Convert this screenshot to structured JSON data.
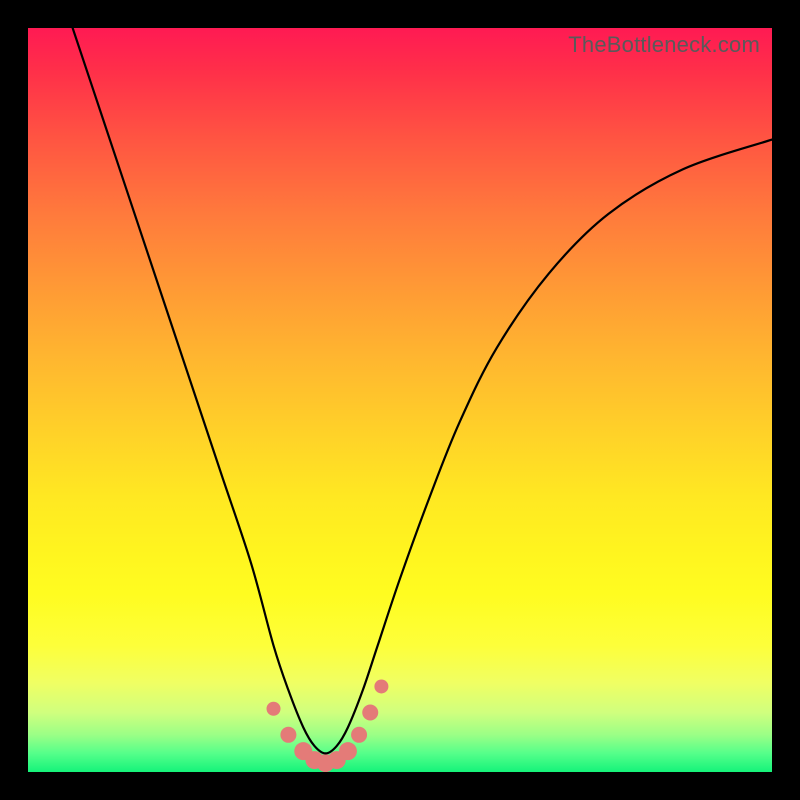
{
  "watermark": "TheBottleneck.com",
  "chart_data": {
    "type": "line",
    "title": "",
    "xlabel": "",
    "ylabel": "",
    "xlim": [
      0,
      100
    ],
    "ylim": [
      0,
      100
    ],
    "series": [
      {
        "name": "bottleneck-curve",
        "x": [
          6,
          10,
          14,
          18,
          22,
          26,
          30,
          33,
          35,
          37,
          38.5,
          40,
          41.5,
          43,
          45,
          47,
          50,
          54,
          58,
          63,
          70,
          78,
          88,
          100
        ],
        "y": [
          100,
          88,
          76,
          64,
          52,
          40,
          28,
          17,
          11,
          6,
          3.5,
          2.5,
          3.5,
          6,
          11,
          17,
          26,
          37,
          47,
          57,
          67,
          75,
          81,
          85
        ]
      }
    ],
    "markers": {
      "name": "highlight-region",
      "color": "#e47b78",
      "points": [
        {
          "x": 33.0,
          "y": 8.5,
          "r": 7
        },
        {
          "x": 35.0,
          "y": 5.0,
          "r": 8
        },
        {
          "x": 37.0,
          "y": 2.8,
          "r": 9
        },
        {
          "x": 38.5,
          "y": 1.6,
          "r": 9
        },
        {
          "x": 40.0,
          "y": 1.2,
          "r": 9
        },
        {
          "x": 41.5,
          "y": 1.6,
          "r": 9
        },
        {
          "x": 43.0,
          "y": 2.8,
          "r": 9
        },
        {
          "x": 44.5,
          "y": 5.0,
          "r": 8
        },
        {
          "x": 46.0,
          "y": 8.0,
          "r": 8
        },
        {
          "x": 47.5,
          "y": 11.5,
          "r": 7
        }
      ]
    }
  }
}
